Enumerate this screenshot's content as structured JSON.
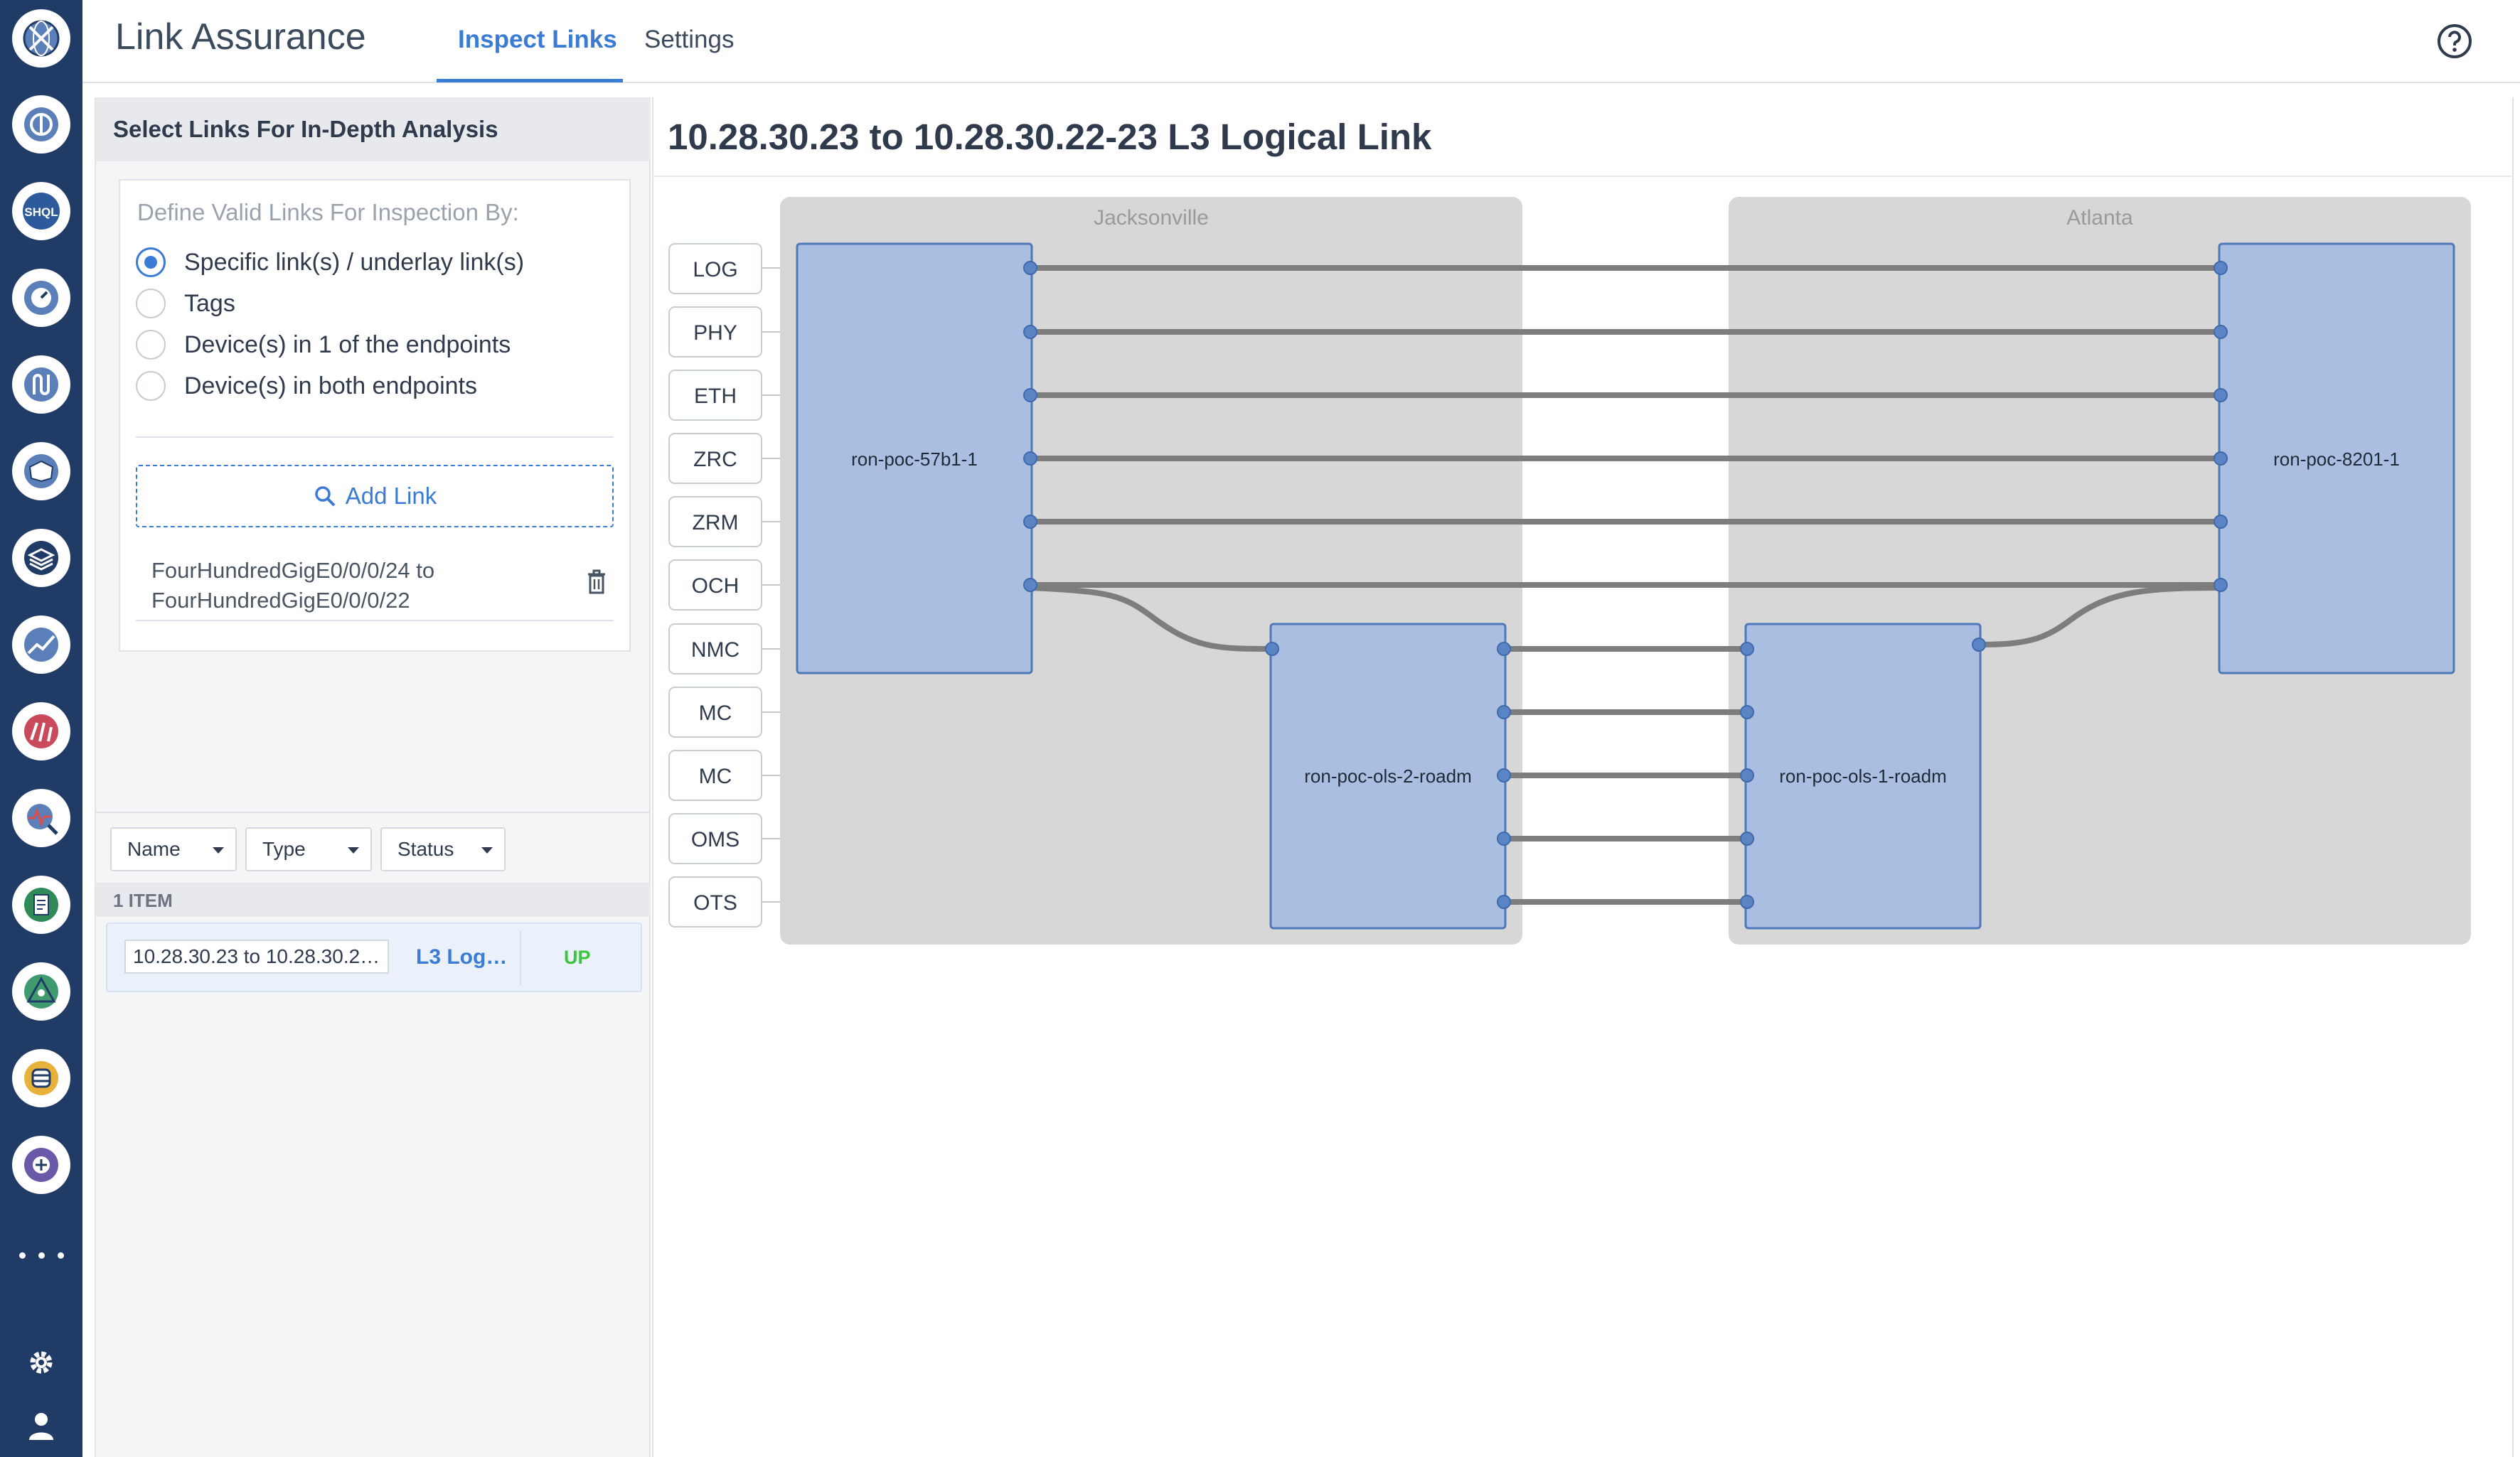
{
  "app": {
    "title": "Link Assurance"
  },
  "tabs": [
    {
      "label": "Inspect Links",
      "active": true
    },
    {
      "label": "Settings",
      "active": false
    }
  ],
  "left_panel": {
    "header": "Select Links For In-Depth Analysis",
    "criteria": {
      "title": "Define Valid Links For Inspection By:",
      "options": [
        {
          "label": "Specific link(s) / underlay link(s)",
          "selected": true
        },
        {
          "label": "Tags",
          "selected": false
        },
        {
          "label": "Device(s) in 1 of the endpoints",
          "selected": false
        },
        {
          "label": "Device(s) in both endpoints",
          "selected": false
        }
      ],
      "add_link_label": "Add Link",
      "selected_links": [
        {
          "line1": "FourHundredGigE0/0/0/24 to",
          "line2": "FourHundredGigE0/0/0/22"
        }
      ]
    },
    "filters": [
      "Name",
      "Type",
      "Status"
    ],
    "items_count": "1 ITEM",
    "results": [
      {
        "name": "10.28.30.23 to 10.28.30.2…",
        "type": "L3 Log…",
        "status": "UP"
      }
    ]
  },
  "detail": {
    "title": "10.28.30.23 to 10.28.30.22-23 L3 Logical Link",
    "sites": [
      "Jacksonville",
      "Atlanta"
    ],
    "layers": [
      "LOG",
      "PHY",
      "ETH",
      "ZRC",
      "ZRM",
      "OCH",
      "NMC",
      "MC",
      "MC",
      "OMS",
      "OTS"
    ],
    "devices": [
      "ron-poc-57b1-1",
      "ron-poc-8201-1",
      "ron-poc-ols-2-roadm",
      "ron-poc-ols-1-roadm"
    ]
  },
  "colors": {
    "rail": "#1f3b66",
    "accent": "#3a7bd5",
    "device_fill": "#a9bee0",
    "device_border": "#4f78b8",
    "site_fill": "#d7d7d7",
    "connection": "#7d7d7d",
    "status_up": "#3cc43c"
  },
  "rail_icons": [
    "globe-icon",
    "analytics-icon",
    "shql-icon",
    "timer-icon",
    "paths-icon",
    "map-icon",
    "layers-icon",
    "chart-icon",
    "speedometer-icon",
    "diagnostics-icon",
    "document-icon",
    "topology-icon",
    "database-icon",
    "add-app-icon",
    "more-icon",
    "gear-icon",
    "user-icon"
  ]
}
